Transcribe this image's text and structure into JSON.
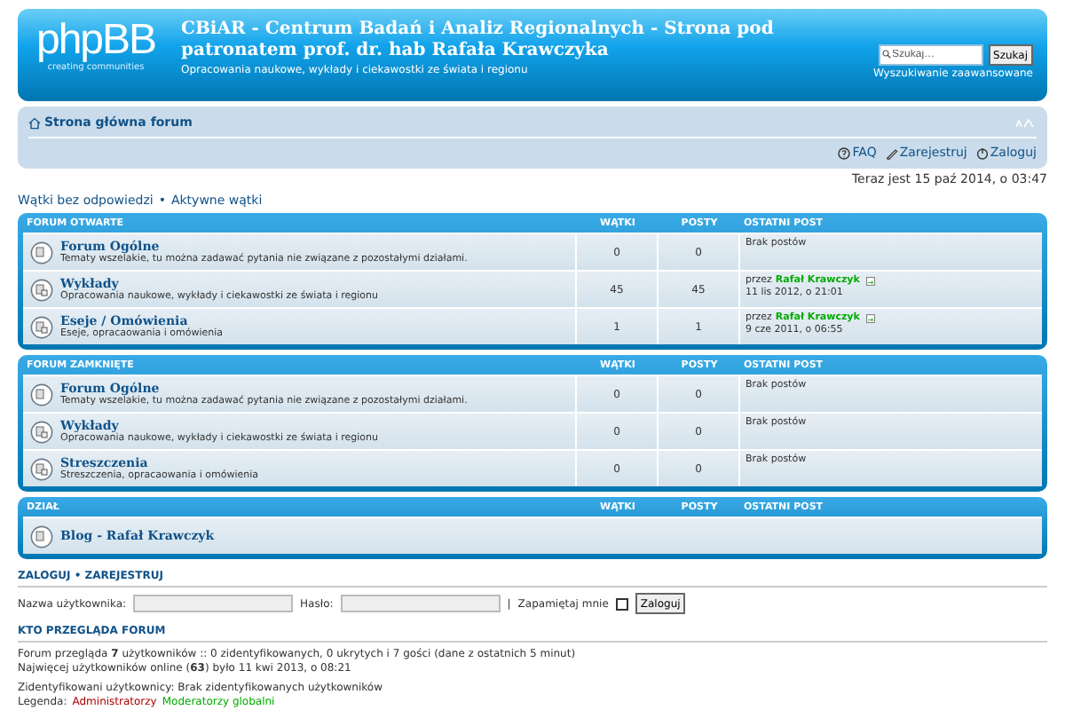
{
  "header": {
    "logo": "phpBB",
    "logo_tagline": "creating communities",
    "title": "CBiAR - Centrum Badań i Analiz Regionalnych - Strona pod patronatem prof. dr. hab Rafała Krawczyka",
    "description": "Opracowania naukowe, wykłady i ciekawostki ze świata i regionu",
    "search_placeholder": "Szukaj…",
    "search_button": "Szukaj",
    "advanced_search": "Wyszukiwanie zaawansowane"
  },
  "navbar": {
    "breadcrumb": "Strona główna forum",
    "links": [
      {
        "kind": "faq",
        "label": "FAQ"
      },
      {
        "kind": "register",
        "label": "Zarejestruj"
      },
      {
        "kind": "login",
        "label": "Zaloguj"
      }
    ]
  },
  "date": "Teraz jest 15 paź 2014, o 03:47",
  "quick_links": {
    "items": [
      "Wątki bez odpowiedzi",
      "Aktywne wątki"
    ],
    "separator": "•"
  },
  "categories": [
    {
      "title": "FORUM OTWARTE",
      "columns": [
        "WĄTKI",
        "POSTY",
        "OSTATNI POST"
      ],
      "forums": [
        {
          "kind": "forum",
          "subforums": false,
          "name": "Forum Ogólne",
          "description": "Tematy wszelakie, tu można zadawać pytania nie związane z pozostałymi działami.",
          "topics": "0",
          "posts": "0",
          "last_post": {
            "kind": "none",
            "text": "Brak postów"
          }
        },
        {
          "kind": "forum",
          "subforums": true,
          "name": "Wykłady",
          "description": "Opracowania naukowe, wykłady i ciekawostki ze świata i regionu",
          "topics": "45",
          "posts": "45",
          "last_post": {
            "kind": "post",
            "by": "przez",
            "author": "Rafał Krawczyk",
            "date": "11 lis 2012, o 21:01"
          }
        },
        {
          "kind": "forum",
          "subforums": true,
          "name": "Eseje / Omówienia",
          "description": "Eseje, opracaowania i omówienia",
          "topics": "1",
          "posts": "1",
          "last_post": {
            "kind": "post",
            "by": "przez",
            "author": "Rafał Krawczyk",
            "date": "9 cze 2011, o 06:55"
          }
        }
      ]
    },
    {
      "title": "FORUM ZAMKNIĘTE",
      "columns": [
        "WĄTKI",
        "POSTY",
        "OSTATNI POST"
      ],
      "forums": [
        {
          "kind": "forum",
          "subforums": false,
          "name": "Forum Ogólne",
          "description": "Tematy wszelakie, tu można zadawać pytania nie związane z pozostałymi działami.",
          "topics": "0",
          "posts": "0",
          "last_post": {
            "kind": "none",
            "text": "Brak postów"
          }
        },
        {
          "kind": "forum",
          "subforums": true,
          "name": "Wykłady",
          "description": "Opracowania naukowe, wykłady i ciekawostki ze świata i regionu",
          "topics": "0",
          "posts": "0",
          "last_post": {
            "kind": "none",
            "text": "Brak postów"
          }
        },
        {
          "kind": "forum",
          "subforums": true,
          "name": "Streszczenia",
          "description": "Streszczenia, opracaowania i omówienia",
          "topics": "0",
          "posts": "0",
          "last_post": {
            "kind": "none",
            "text": "Brak postów"
          }
        }
      ]
    },
    {
      "title": "DZIAŁ",
      "columns": [
        "WĄTKI",
        "POSTY",
        "OSTATNI POST"
      ],
      "forums": [
        {
          "kind": "link",
          "subforums": false,
          "name": "Blog - Rafał Krawczyk"
        }
      ]
    }
  ],
  "login": {
    "title": "ZALOGUJ • ZAREJESTRUJ",
    "username_label": "Nazwa użytkownika:",
    "password_label": "Hasło:",
    "separator": "|",
    "remember_label": "Zapamiętaj mnie",
    "remember_checked": false,
    "button": "Zaloguj"
  },
  "who_is_online": {
    "title": "KTO PRZEGLĄDA FORUM",
    "lines": [
      "Forum przegląda **7** użytkowników :: 0 zidentyfikowanych, 0 ukrytych i 7 gości (dane z ostatnich 5 minut)",
      "Najwięcej użytkowników online (**63**) było 11 kwi 2013, o 08:21"
    ],
    "registered": "Zidentyfikowani użytkownicy: Brak zidentyfikowanych użytkowników",
    "legend_label": "Legenda:",
    "legend": [
      {
        "name": "Administratorzy",
        "color": "#aa0000"
      },
      {
        "name": "Moderatorzy globalni",
        "color": "#00aa00"
      }
    ]
  }
}
